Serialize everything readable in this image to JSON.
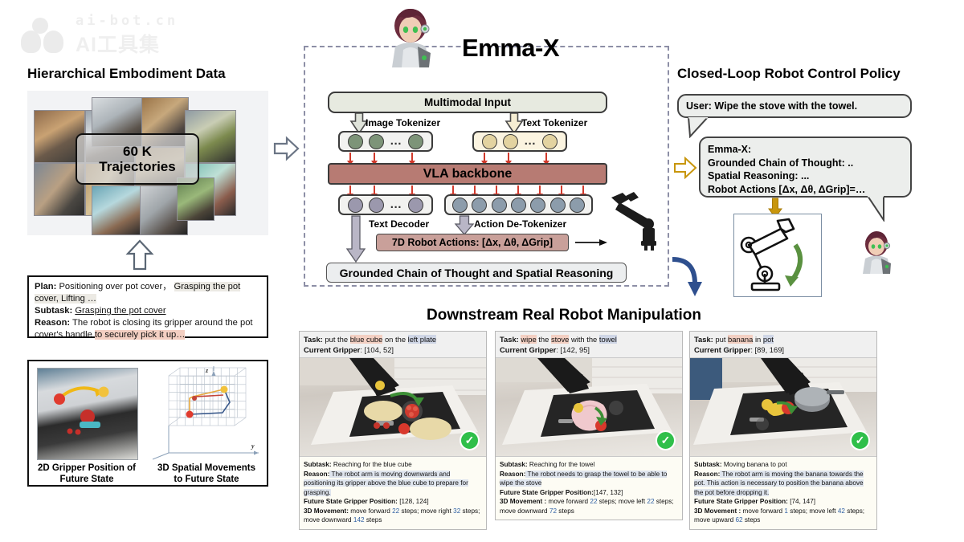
{
  "watermark": {
    "en": "ai-bot.cn",
    "cn": "AI工具集"
  },
  "sections": {
    "left_title": "Hierarchical Embodiment Data",
    "center_title": "Emma-X",
    "right_title": "Closed-Loop Robot Control Policy",
    "bottom_title": "Downstream Real Robot Manipulation"
  },
  "collage": {
    "overlay_line1": "60 K",
    "overlay_line2": "Trajectories"
  },
  "plan_box": {
    "plan_label": "Plan:",
    "plan_text_1": "Positioning over pot cover，",
    "plan_text_hl": "Grasping the pot cover, Lifting …",
    "subtask_label": "Subtask:",
    "subtask_text": "Grasping the pot cover",
    "reason_label": "Reason:",
    "reason_text_1": "The robot is closing its gripper around the pot cover's handle ",
    "reason_text_hl": "to securely pick it up…"
  },
  "figures": {
    "fig1_caption_line1": "2D Gripper Position of",
    "fig1_caption_line2": "Future State",
    "fig2_caption_line1": "3D Spatial Movements",
    "fig2_caption_line2": "to Future State",
    "axis_z": "z",
    "axis_y": "y"
  },
  "pipeline": {
    "multimodal_input": "Multimodal Input",
    "image_tokenizer": "Image Tokenizer",
    "text_tokenizer": "Text Tokenizer",
    "vla_backbone": "VLA backbone",
    "text_decoder": "Text Decoder",
    "action_detokenizer": "Action De-Tokenizer",
    "robot_actions": "7D Robot Actions:  [Δx, Δθ, ΔGrip]",
    "grounded_cot": "Grounded Chain of Thought and Spatial Reasoning"
  },
  "policy": {
    "user_bubble": "User:  Wipe the stove with the towel.",
    "emma_line1": "Emma-X:",
    "emma_line2": "Grounded Chain of Thought: ..",
    "emma_line3": "Spatial Reasoning: ...",
    "emma_line4": "Robot Actions [Δx, Δθ, ΔGrip]=…"
  },
  "colors": {
    "vla_backbone": "#b77b73",
    "action_bar": "#c9a09a",
    "multimodal": "#e7eae0",
    "image_token": "#7d9478",
    "text_token": "#e3d3a0",
    "text_out_token": "#9b98ad",
    "action_token": "#8c9cab",
    "red_arrow": "#d0392b",
    "blue_arrow": "#2e4f8e",
    "gold_arrow": "#c8960c",
    "check_green": "#2fbf4a",
    "dashed_border": "#8d8fa6"
  },
  "downstream": [
    {
      "task_label": "Task:",
      "task_pre": "put the ",
      "task_obj": "blue cube",
      "task_mid": " on the ",
      "task_target": "left plate",
      "gripper_label": "Current Gripper",
      "gripper_value": ": [104, 52]",
      "subtask_label": "Subtask:",
      "subtask_value": " Reaching for the blue cube",
      "reason_label": "Reason:",
      "reason_value": " The robot arm is moving downwards and positioning its gripper above the blue cube to prepare for grasping.",
      "future_label": "Future State Gripper Position:",
      "future_value": " [128, 124]",
      "move_label": "3D Movement:",
      "move_parts": [
        "move forward ",
        "22",
        " steps; move right ",
        "32",
        " steps; move downward ",
        "142",
        " steps"
      ]
    },
    {
      "task_label": "Task:",
      "task_pre": "",
      "task_obj": "wipe",
      "task_mid": " the ",
      "task_target": "stove",
      "task_post": " with the ",
      "task_tool": "towel",
      "gripper_label": "Current Gripper",
      "gripper_value": ": [142, 95]",
      "subtask_label": "Subtask:",
      "subtask_value": " Reaching for the towel",
      "reason_label": "Reason:",
      "reason_value": " The robot needs to grasp the towel to be able to wipe the stove",
      "future_label": "Future State Gripper Position:",
      "future_value": "[147, 132]",
      "move_label": "3D Movement :",
      "move_parts": [
        "move forward ",
        "22",
        " steps; move left ",
        "22",
        " steps; move downward ",
        "72",
        " steps"
      ]
    },
    {
      "task_label": "Task:",
      "task_pre": "put ",
      "task_obj": "banana",
      "task_mid": " in ",
      "task_target": "pot",
      "gripper_label": "Current Gripper",
      "gripper_value": ": [89, 169]",
      "subtask_label": "Subtask:",
      "subtask_value": " Moving banana to pot",
      "reason_label": "Reason:",
      "reason_value": " The robot arm is moving the banana towards the pot. This action is necessary to position the banana above the pot before dropping it.",
      "future_label": "Future State Gripper Position:",
      "future_value": " [74, 147]",
      "move_label": "3D Movement :",
      "move_parts": [
        "move forward ",
        "1",
        " steps; move left ",
        "42",
        " steps; move upward ",
        "62",
        " steps"
      ]
    }
  ]
}
